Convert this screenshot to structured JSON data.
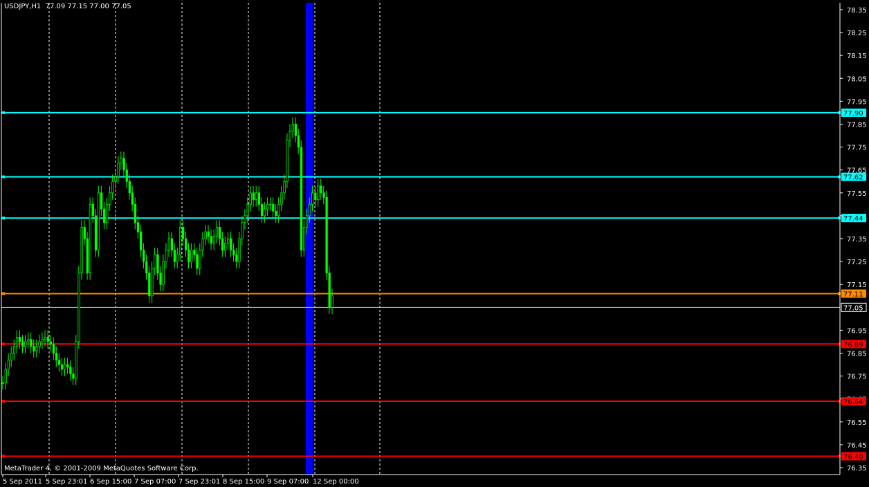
{
  "header": {
    "symbol_timeframe": "USDJPY,H1",
    "ohlc": "77.09 77.15 77.00 77.05"
  },
  "footer": {
    "copyright": "MetaTrader 4, © 2001-2009 MetaQuotes Software Corp."
  },
  "colors": {
    "background": "#000000",
    "candles": "#00ff00",
    "grid": "#ffffff",
    "axis": "#ffffff",
    "resistance": "#00ffff",
    "pivot": "#ff8c00",
    "support": "#ff0000",
    "bid_line": "#c0c0c0",
    "session_band": "#0000ff"
  },
  "price_axis": {
    "ticks": [
      78.35,
      78.25,
      78.15,
      78.05,
      77.95,
      77.85,
      77.75,
      77.65,
      77.55,
      77.45,
      77.35,
      77.25,
      77.15,
      76.95,
      76.85,
      76.75,
      76.65,
      76.55,
      76.45,
      76.35
    ],
    "current_price_label": "77.05"
  },
  "time_axis": {
    "labels": [
      "5 Sep 2011",
      "5 Sep 23:01",
      "6 Sep 15:00",
      "7 Sep 07:00",
      "7 Sep 23:01",
      "8 Sep 15:00",
      "9 Sep 07:00",
      "12 Sep 00:00"
    ]
  },
  "horizontal_levels": [
    {
      "price": 77.9,
      "label": "77.90",
      "kind": "resistance"
    },
    {
      "price": 77.62,
      "label": "77.62",
      "kind": "resistance"
    },
    {
      "price": 77.44,
      "label": "77.44",
      "kind": "resistance"
    },
    {
      "price": 77.11,
      "label": "77.11",
      "kind": "pivot"
    },
    {
      "price": 76.89,
      "label": "76.89",
      "kind": "support"
    },
    {
      "price": 76.64,
      "label": "76.64",
      "kind": "support"
    },
    {
      "price": 76.4,
      "label": "76.40",
      "kind": "support"
    }
  ],
  "current_price": 77.05,
  "chart_data": {
    "type": "line",
    "title": "USDJPY,H1",
    "x": [
      "5 Sep 2011",
      "5 Sep 23:01",
      "6 Sep 15:00",
      "7 Sep 07:00",
      "7 Sep 23:01",
      "8 Sep 15:00",
      "9 Sep 07:00",
      "12 Sep 00:00"
    ],
    "ylim": [
      76.32,
      78.38
    ],
    "grid": true,
    "series": [
      {
        "values": [
          76.72,
          76.78,
          76.82,
          76.85,
          76.88,
          76.92,
          76.9,
          76.88,
          76.9,
          76.91,
          76.88,
          76.86,
          76.88,
          76.9,
          76.91,
          76.92,
          76.9,
          76.89,
          76.85,
          76.82,
          76.8,
          76.78,
          76.8,
          76.79,
          76.76,
          76.74,
          76.9,
          77.2,
          77.4,
          77.35,
          77.2,
          77.5,
          77.45,
          77.3,
          77.55,
          77.48,
          77.42,
          77.5,
          77.55,
          77.6,
          77.62,
          77.68,
          77.7,
          77.65,
          77.6,
          77.55,
          77.5,
          77.42,
          77.38,
          77.3,
          77.25,
          77.2,
          77.1,
          77.22,
          77.28,
          77.2,
          77.15,
          77.25,
          77.3,
          77.35,
          77.3,
          77.25,
          77.28,
          77.4,
          77.35,
          77.3,
          77.25,
          77.3,
          77.28,
          77.22,
          77.3,
          77.35,
          77.38,
          77.36,
          77.33,
          77.36,
          77.4,
          77.35,
          77.3,
          77.33,
          77.35,
          77.3,
          77.28,
          77.25,
          77.35,
          77.42,
          77.45,
          77.5,
          77.55,
          77.52,
          77.55,
          77.5,
          77.45,
          77.48,
          77.5,
          77.5,
          77.47,
          77.45,
          77.5,
          77.55,
          77.6,
          77.78,
          77.82,
          77.85,
          77.8,
          77.75,
          77.3,
          77.4,
          77.45,
          77.5,
          77.55,
          77.52,
          77.58,
          77.55,
          77.53,
          77.2,
          77.05,
          77.1
        ]
      }
    ]
  }
}
